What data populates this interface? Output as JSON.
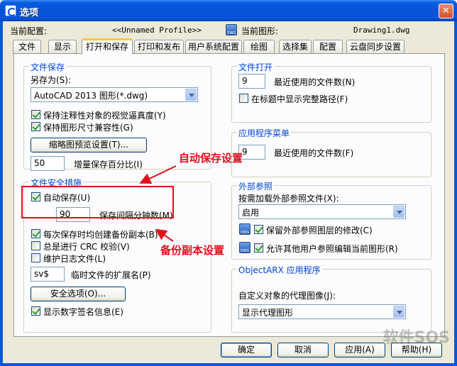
{
  "window": {
    "title": "选项",
    "close": "✕"
  },
  "profile": {
    "label": "当前配置:",
    "value": "<<Unnamed Profile>>"
  },
  "drawing": {
    "label": "当前图形:",
    "value": "Drawing1.dwg"
  },
  "tabs": [
    {
      "label": "文件"
    },
    {
      "label": "显示"
    },
    {
      "label": "打开和保存"
    },
    {
      "label": "打印和发布"
    },
    {
      "label": "用户系统配置"
    },
    {
      "label": "绘图"
    },
    {
      "label": "选择集"
    },
    {
      "label": "配置"
    },
    {
      "label": "云盘同步设置"
    }
  ],
  "file_save": {
    "title": "文件保存",
    "save_as_label": "另存为(S):",
    "save_as_value": "AutoCAD 2013 图形(*.dwg)",
    "keep_annotative": "保持注释性对象的视觉逼真度(Y)",
    "keep_size": "保持图形尺寸兼容性(G)",
    "thumbnail_button": "缩略图预览设置(T)...",
    "incremental_value": "50",
    "incremental_label": "增量保存百分比(I)"
  },
  "safety": {
    "title": "文件安全措施",
    "autosave": "自动保存(U)",
    "interval_value": "90",
    "interval_label": "保存间隔分钟数(M)",
    "backup": "每次保存时均创建备份副本(B)",
    "crc": "总是进行 CRC 校验(V)",
    "log": "维护日志文件(L)",
    "ext_value": "sv$",
    "ext_label": "临时文件的扩展名(P)",
    "security_button": "安全选项(O)...",
    "signature": "显示数字签名信息(E)"
  },
  "file_open": {
    "title": "文件打开",
    "recent_value": "9",
    "recent_label": "最近使用的文件数(N)",
    "full_path": "在标题中显示完整路径(F)"
  },
  "app_menu": {
    "title": "应用程序菜单",
    "recent_value": "9",
    "recent_label": "最近使用的文件数(F)"
  },
  "xref": {
    "title": "外部参照",
    "demand_label": "按需加载外部参照文件(X):",
    "demand_value": "启用",
    "retain": "保留外部参照图层的修改(C)",
    "allow_edit": "允许其他用户参照编辑当前图形(R)"
  },
  "objectarx": {
    "title": "ObjectARX 应用程序",
    "proxy_label": "自定义对象的代理图像(J):",
    "proxy_value": "显示代理图形"
  },
  "annotations": {
    "autosave": "自动保存设置",
    "backup": "备份副本设置"
  },
  "buttons": {
    "ok": "确定",
    "cancel": "取消",
    "apply": "应用(A)",
    "help": "帮助(H)"
  },
  "watermark": "软件SOS",
  "colors": {
    "annotation": "#e0101a",
    "group_title": "#0046d5",
    "title_bar": "#0653d6"
  }
}
